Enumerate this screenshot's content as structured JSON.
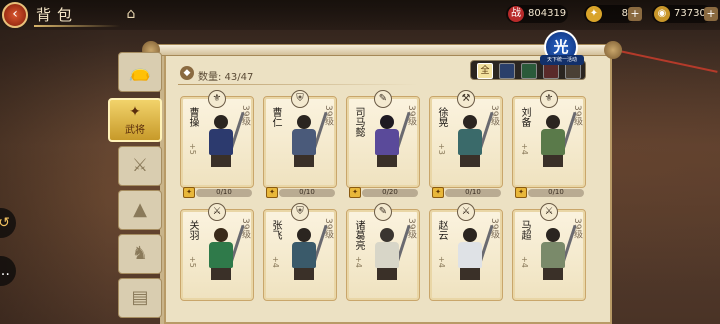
{
  "header": {
    "title": "背包",
    "back_icon": "back-arrow-icon",
    "home_icon": "home-icon"
  },
  "resources": {
    "power": "804319",
    "tokens": "8",
    "copper": "73730"
  },
  "bag": {
    "count_label": "数量: 43/47"
  },
  "side_tabs": [
    {
      "icon": "bag-icon",
      "label": ""
    },
    {
      "icon": "general-icon",
      "label": "武将"
    },
    {
      "icon": "sword-icon",
      "label": ""
    },
    {
      "icon": "helmet-icon",
      "label": ""
    },
    {
      "icon": "horse-icon",
      "label": ""
    },
    {
      "icon": "book-icon",
      "label": ""
    }
  ],
  "filters": [
    "全",
    "",
    "",
    "",
    ""
  ],
  "badge": {
    "char": "光",
    "caption": "天下统一活动"
  },
  "heroes": [
    {
      "name": "曹操",
      "plus": "+5",
      "level": "39级",
      "cls": "⚜",
      "shards": "0/10",
      "progress": 0,
      "head": "#2b2520",
      "body": "#2c3a6e"
    },
    {
      "name": "曹仁",
      "plus": "",
      "level": "39级",
      "cls": "⛨",
      "shards": "0/10",
      "progress": 0,
      "head": "#2b2520",
      "body": "#4a5a7a"
    },
    {
      "name": "司马懿",
      "plus": "",
      "level": "39级",
      "cls": "✎",
      "shards": "0/20",
      "progress": 0,
      "head": "#1e1a22",
      "body": "#5a4a9a"
    },
    {
      "name": "徐晃",
      "plus": "+3",
      "level": "39级",
      "cls": "⚒",
      "shards": "0/10",
      "progress": 0,
      "head": "#2b2520",
      "body": "#3a6a6a"
    },
    {
      "name": "刘备",
      "plus": "+4",
      "level": "39级",
      "cls": "⚜",
      "shards": "0/10",
      "progress": 0,
      "head": "#2b2520",
      "body": "#5a7a4a"
    },
    {
      "name": "关羽",
      "plus": "+5",
      "level": "39级",
      "cls": "⚔",
      "shards": "",
      "progress": 0,
      "head": "#3a2a1a",
      "body": "#2f7a4a"
    },
    {
      "name": "张飞",
      "plus": "+4",
      "level": "39级",
      "cls": "⛨",
      "shards": "",
      "progress": 0,
      "head": "#2b2520",
      "body": "#3a5a6a"
    },
    {
      "name": "诸葛亮",
      "plus": "+4",
      "level": "39级",
      "cls": "✎",
      "shards": "",
      "progress": 0,
      "head": "#3a3530",
      "body": "#d8d6c8"
    },
    {
      "name": "赵云",
      "plus": "+4",
      "level": "39级",
      "cls": "⚔",
      "shards": "",
      "progress": 0,
      "head": "#2b2520",
      "body": "#dfe2e6"
    },
    {
      "name": "马超",
      "plus": "+4",
      "level": "39级",
      "cls": "⚔",
      "shards": "",
      "progress": 0,
      "head": "#2b2520",
      "body": "#7a8a6a"
    }
  ]
}
